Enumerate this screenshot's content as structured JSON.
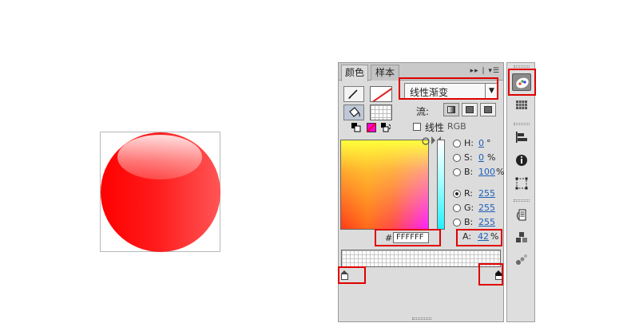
{
  "panel": {
    "tabs": [
      {
        "label": "颜色",
        "active": true
      },
      {
        "label": "样本",
        "active": false
      }
    ],
    "fill_type": "线性渐变",
    "flow_label": "流:",
    "linear_label": "线性",
    "rgb_label": "RGB",
    "hex_prefix": "#",
    "hex_value": "FFFFFF",
    "fields": {
      "h": {
        "label": "H:",
        "value": "0",
        "unit": "°"
      },
      "s": {
        "label": "S:",
        "value": "0",
        "unit": "%"
      },
      "b": {
        "label": "B:",
        "value": "100",
        "unit": "%"
      },
      "r": {
        "label": "R:",
        "value": "255",
        "unit": ""
      },
      "g": {
        "label": "G:",
        "value": "255",
        "unit": ""
      },
      "b2": {
        "label": "B:",
        "value": "255",
        "unit": ""
      },
      "a": {
        "label": "A:",
        "value": "42",
        "unit": "%"
      }
    },
    "selected_channel": "R"
  },
  "colors": {
    "highlight": "#e00000",
    "sphere": "#ff0000",
    "link_value": "#1f5fb8"
  },
  "toolbar": {
    "icons": [
      "color-icon",
      "swatches-icon",
      "align-icon",
      "info-icon",
      "transform-icon",
      "components-icon",
      "library-icon",
      "motion-icon"
    ]
  }
}
